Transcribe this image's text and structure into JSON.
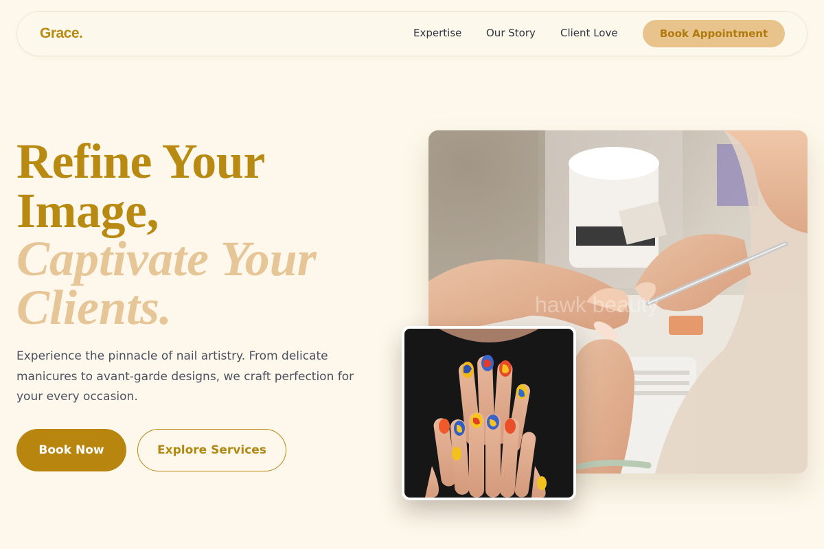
{
  "nav": {
    "logo": "Grace.",
    "links": [
      "Expertise",
      "Our Story",
      "Client Love"
    ],
    "cta": "Book Appointment"
  },
  "hero": {
    "line1": "Refine Your",
    "line2": "Image,",
    "line3": "Captivate Your",
    "line4": "Clients.",
    "description": "Experience the pinnacle of nail artistry. From delicate manicures to avant-garde designs, we craft perfection for your every occasion.",
    "primary_button": "Book Now",
    "secondary_button": "Explore Services"
  },
  "images": {
    "main_photo": "manicure-in-progress-photo",
    "main_photo_watermark": "hawk beauty",
    "inset_photo": "colorful-nail-art-hands-photo"
  },
  "colors": {
    "background": "#fdf8eb",
    "gold": "#b98a12",
    "light_gold": "#e6c596",
    "cta_fill": "#e8c38c",
    "body_text": "#4b5160"
  }
}
